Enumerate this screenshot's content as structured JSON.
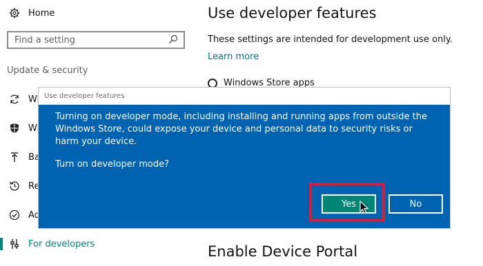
{
  "sidebar": {
    "home": {
      "label": "Home",
      "icon": "gear-icon"
    },
    "search": {
      "placeholder": "Find a setting",
      "icon": "search-icon"
    },
    "section_label": "Update & security",
    "items": [
      {
        "label": "Wi",
        "icon": "sync-icon"
      },
      {
        "label": "Wi",
        "icon": "shield-icon"
      },
      {
        "label": "Ba",
        "icon": "backup-arrow-icon"
      },
      {
        "label": "Re",
        "icon": "history-icon"
      },
      {
        "label": "Ac",
        "icon": "check-circle-icon"
      },
      {
        "label": "For developers",
        "icon": "developer-tools-icon",
        "active": true
      }
    ]
  },
  "main": {
    "title": "Use developer features",
    "description": "These settings are intended for development use only.",
    "learn_more": "Learn more",
    "option_windows_store": "Windows Store apps",
    "portal_title": "Enable Device Portal"
  },
  "dialog": {
    "title": "Use developer features",
    "message": "Turning on developer mode, including installing and running apps from outside the Windows Store, could expose your device and personal data to security risks or harm your device.",
    "question": "Turn on developer mode?",
    "yes_label": "Yes",
    "no_label": "No"
  },
  "colors": {
    "accent": "#00847b",
    "dialog_bg": "#0063b1",
    "yes_button": "#008575",
    "highlight": "#d81d3b"
  }
}
